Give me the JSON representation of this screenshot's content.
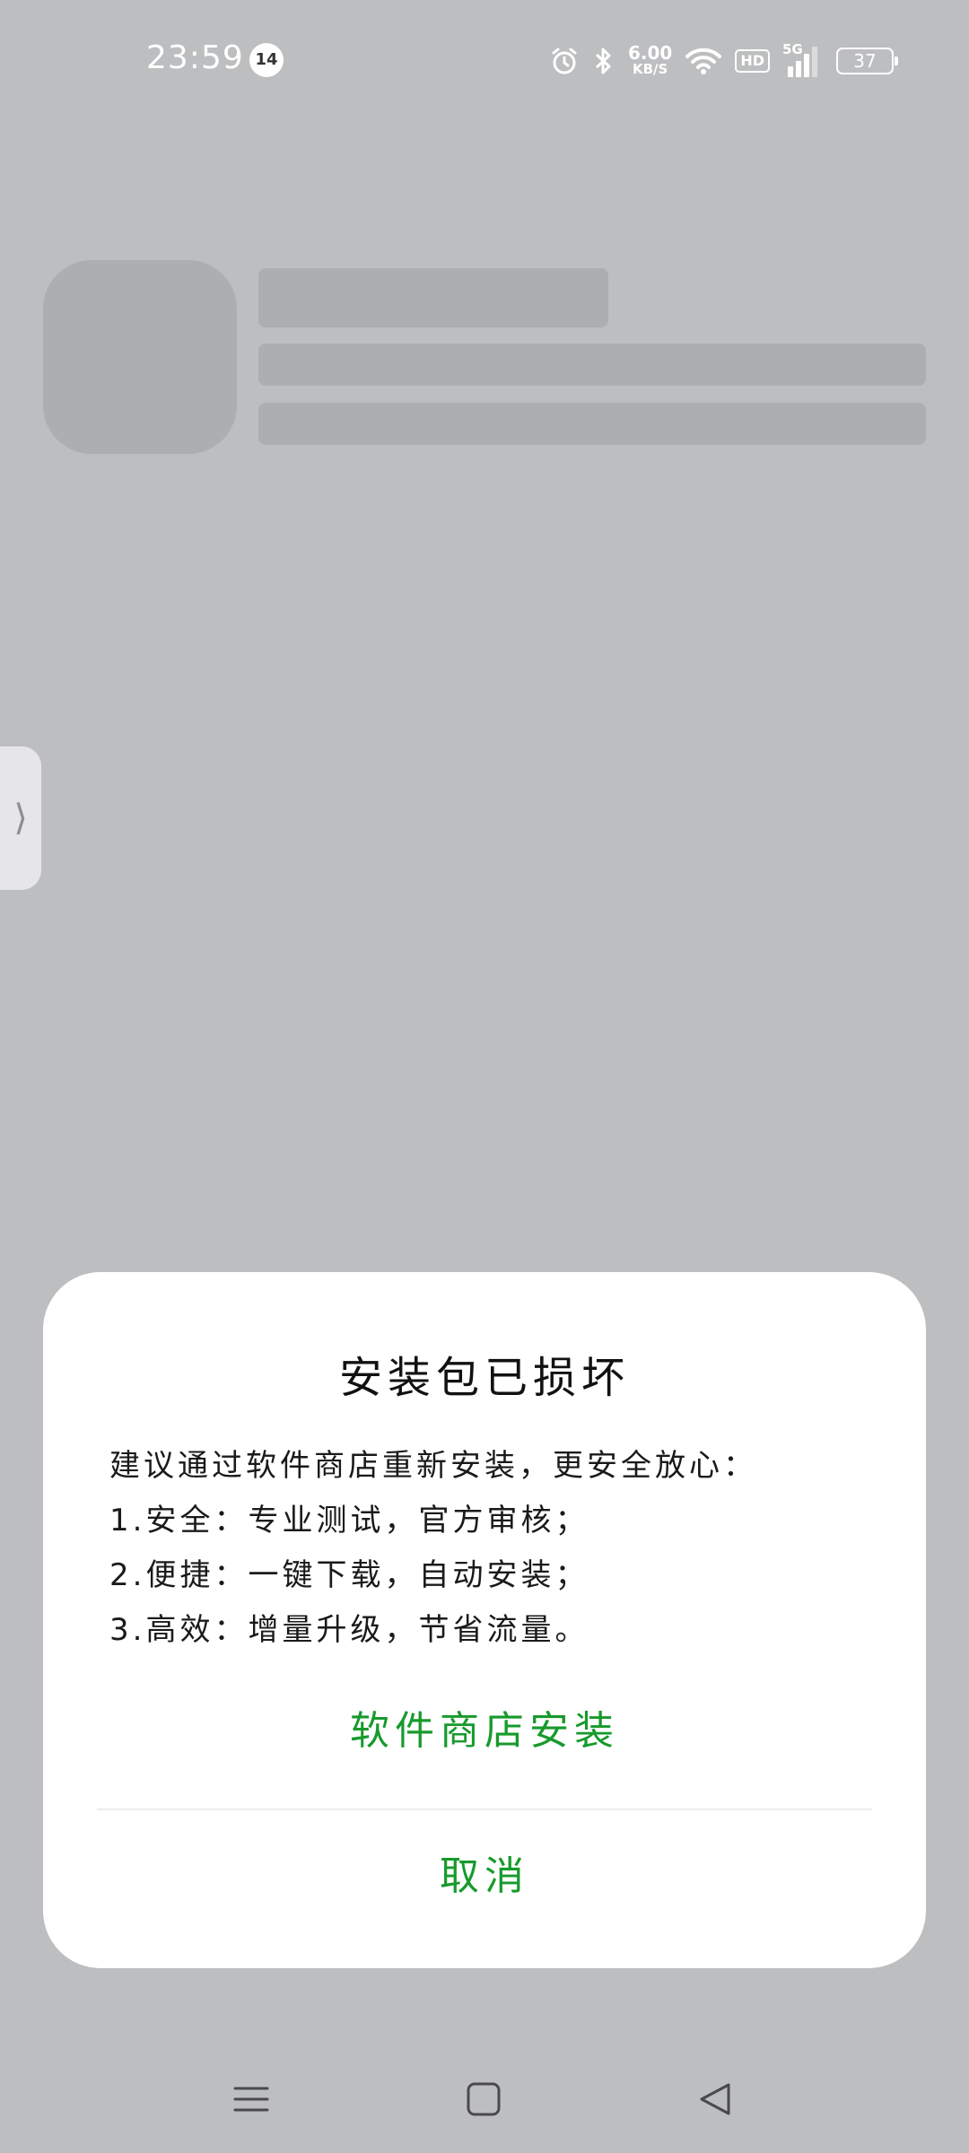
{
  "status_bar": {
    "time": "23:59",
    "notification_count": "14",
    "net_speed_value": "6.00",
    "net_speed_unit": "KB/S",
    "hd_label": "HD",
    "network_type": "5G",
    "battery": "37",
    "icons": [
      "alarm-icon",
      "bluetooth-icon",
      "wifi-icon",
      "signal-icon",
      "battery-icon"
    ]
  },
  "side_handle": {
    "glyph": "⟩"
  },
  "dialog": {
    "title": "安装包已损坏",
    "body_lines": [
      "建议通过软件商店重新安装，更安全放心：",
      "1.安全：专业测试，官方审核；",
      "2.便捷：一键下载，自动安装；",
      "3.高效：增量升级，节省流量。"
    ],
    "primary_button": "软件商店安装",
    "cancel_button": "取消",
    "accent_color": "#179a2c"
  },
  "nav_bar": {
    "icons": [
      "menu-icon",
      "home-icon",
      "back-icon"
    ]
  }
}
